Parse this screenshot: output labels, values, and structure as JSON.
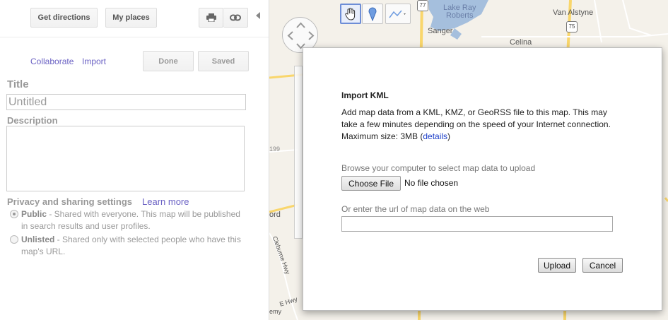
{
  "left_panel": {
    "get_directions_label": "Get directions",
    "my_places_label": "My places",
    "print_icon": "printer-icon",
    "link_icon": "link-icon",
    "collaborate_label": "Collaborate",
    "import_label": "Import",
    "done_label": "Done",
    "saved_label": "Saved",
    "title_heading": "Title",
    "title_value": "Untitled",
    "description_heading": "Description",
    "description_value": "",
    "privacy_heading": "Privacy and sharing settings",
    "learn_more_label": "Learn more",
    "privacy_options": [
      {
        "label": "Public",
        "description": " - Shared with everyone. This map will be published in search results and user profiles.",
        "selected": true
      },
      {
        "label": "Unlisted",
        "description": " - Shared only with selected people who have this map's URL.",
        "selected": false
      }
    ]
  },
  "map": {
    "labels": {
      "lake_ray_roberts": "Lake Ray\nRoberts",
      "van_alstyne": "Van Alstyne",
      "sanger": "Sanger",
      "celina": "Celina",
      "cleburne_hwy": "Cleburne Hwy",
      "ford": "ord",
      "ewy": "E Hwy",
      "emy": "emy"
    },
    "shields": {
      "r77": "77",
      "r75": "75",
      "r199": "199"
    },
    "tools": {
      "hand": "hand-icon",
      "pin": "placemark-icon",
      "line": "line-icon"
    },
    "colors": {
      "water": "#a5bfdd",
      "highway": "#f9d66b",
      "land": "#f4f1ea"
    }
  },
  "dialog": {
    "title": "Import KML",
    "description": "Add map data from a KML, KMZ, or GeoRSS file to this map. This may take a few minutes depending on the speed of your Internet connection.",
    "max_size_prefix": "Maximum size: 3MB (",
    "details_label": "details",
    "max_size_suffix": ")",
    "browse_label": "Browse your computer to select map data to upload",
    "choose_file_label": "Choose File",
    "no_file_label": "No file chosen",
    "url_label": "Or enter the url of map data on the web",
    "url_value": "",
    "upload_label": "Upload",
    "cancel_label": "Cancel"
  }
}
